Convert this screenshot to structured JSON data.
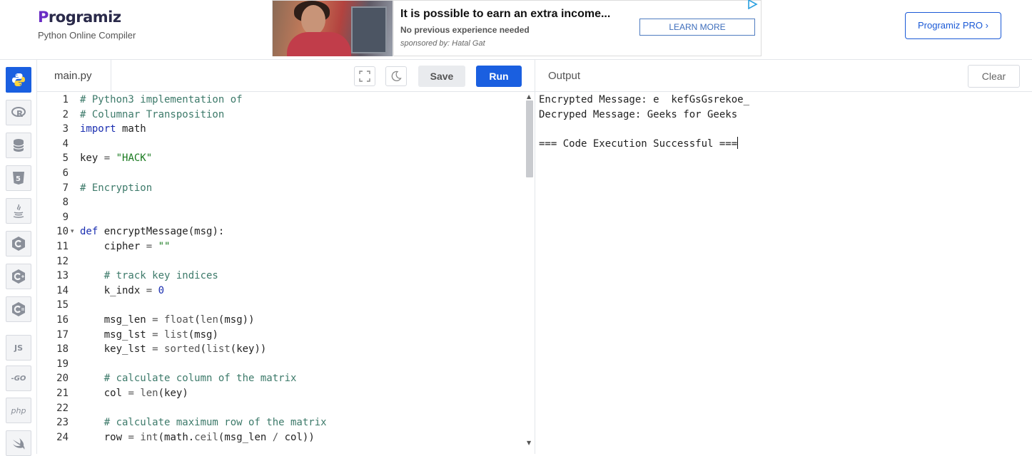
{
  "header": {
    "logo_text": "Programiz",
    "logo_subtitle": "Python Online Compiler",
    "pro_button_label": "Programiz PRO ›"
  },
  "ad": {
    "title": "It is possible to earn an extra income...",
    "subtitle": "No previous experience needed",
    "sponsor": "sponsored by: Hatal Gat",
    "button_label": "LEARN MORE"
  },
  "sidebar": {
    "items": [
      {
        "name": "python",
        "label": "",
        "active": true
      },
      {
        "name": "r",
        "label": "R",
        "active": false
      },
      {
        "name": "sql",
        "label": "",
        "active": false
      },
      {
        "name": "html",
        "label": "5",
        "active": false
      },
      {
        "name": "java",
        "label": "",
        "active": false
      },
      {
        "name": "c",
        "label": "C",
        "active": false
      },
      {
        "name": "cpp",
        "label": "C",
        "active": false
      },
      {
        "name": "csharp",
        "label": "C",
        "active": false
      },
      {
        "name": "js",
        "label": "JS",
        "active": false
      },
      {
        "name": "go",
        "label": "-GO",
        "active": false
      },
      {
        "name": "php",
        "label": "php",
        "active": false
      },
      {
        "name": "swift",
        "label": "",
        "active": false
      }
    ]
  },
  "editor": {
    "file_name": "main.py",
    "save_label": "Save",
    "run_label": "Run",
    "lines": [
      [
        {
          "t": "# Python3 implementation of",
          "c": "comment"
        }
      ],
      [
        {
          "t": "# Columnar Transposition",
          "c": "comment"
        }
      ],
      [
        {
          "t": "import",
          "c": "kw"
        },
        {
          "t": " math",
          "c": ""
        }
      ],
      [],
      [
        {
          "t": "key ",
          "c": ""
        },
        {
          "t": "=",
          "c": "fn"
        },
        {
          "t": " ",
          "c": ""
        },
        {
          "t": "\"HACK\"",
          "c": "str"
        }
      ],
      [],
      [
        {
          "t": "# Encryption",
          "c": "comment"
        }
      ],
      [],
      [],
      [
        {
          "t": "def",
          "c": "kw"
        },
        {
          "t": " encryptMessage(msg):",
          "c": ""
        }
      ],
      [
        {
          "t": "    cipher ",
          "c": ""
        },
        {
          "t": "=",
          "c": "fn"
        },
        {
          "t": " ",
          "c": ""
        },
        {
          "t": "\"\"",
          "c": "str"
        }
      ],
      [],
      [
        {
          "t": "    # track key indices",
          "c": "comment"
        }
      ],
      [
        {
          "t": "    k_indx ",
          "c": ""
        },
        {
          "t": "=",
          "c": "fn"
        },
        {
          "t": " ",
          "c": ""
        },
        {
          "t": "0",
          "c": "num"
        }
      ],
      [],
      [
        {
          "t": "    msg_len ",
          "c": ""
        },
        {
          "t": "=",
          "c": "fn"
        },
        {
          "t": " ",
          "c": ""
        },
        {
          "t": "float",
          "c": "fn"
        },
        {
          "t": "(",
          "c": ""
        },
        {
          "t": "len",
          "c": "fn"
        },
        {
          "t": "(msg))",
          "c": ""
        }
      ],
      [
        {
          "t": "    msg_lst ",
          "c": ""
        },
        {
          "t": "=",
          "c": "fn"
        },
        {
          "t": " ",
          "c": ""
        },
        {
          "t": "list",
          "c": "fn"
        },
        {
          "t": "(msg)",
          "c": ""
        }
      ],
      [
        {
          "t": "    key_lst ",
          "c": ""
        },
        {
          "t": "=",
          "c": "fn"
        },
        {
          "t": " ",
          "c": ""
        },
        {
          "t": "sorted",
          "c": "fn"
        },
        {
          "t": "(",
          "c": ""
        },
        {
          "t": "list",
          "c": "fn"
        },
        {
          "t": "(key))",
          "c": ""
        }
      ],
      [],
      [
        {
          "t": "    # calculate column of the matrix",
          "c": "comment"
        }
      ],
      [
        {
          "t": "    col ",
          "c": ""
        },
        {
          "t": "=",
          "c": "fn"
        },
        {
          "t": " ",
          "c": ""
        },
        {
          "t": "len",
          "c": "fn"
        },
        {
          "t": "(key)",
          "c": ""
        }
      ],
      [],
      [
        {
          "t": "    # calculate maximum row of the matrix",
          "c": "comment"
        }
      ],
      [
        {
          "t": "    row ",
          "c": ""
        },
        {
          "t": "=",
          "c": "fn"
        },
        {
          "t": " ",
          "c": ""
        },
        {
          "t": "int",
          "c": "fn"
        },
        {
          "t": "(math.",
          "c": ""
        },
        {
          "t": "ceil",
          "c": "fn"
        },
        {
          "t": "(msg_len ",
          "c": ""
        },
        {
          "t": "/",
          "c": "fn"
        },
        {
          "t": " col))",
          "c": ""
        }
      ]
    ]
  },
  "output": {
    "title": "Output",
    "clear_label": "Clear",
    "lines": [
      "Encrypted Message: e  kefGsGsrekoe_",
      "Decryped Message: Geeks for Geeks",
      "",
      "=== Code Execution Successful ==="
    ]
  }
}
